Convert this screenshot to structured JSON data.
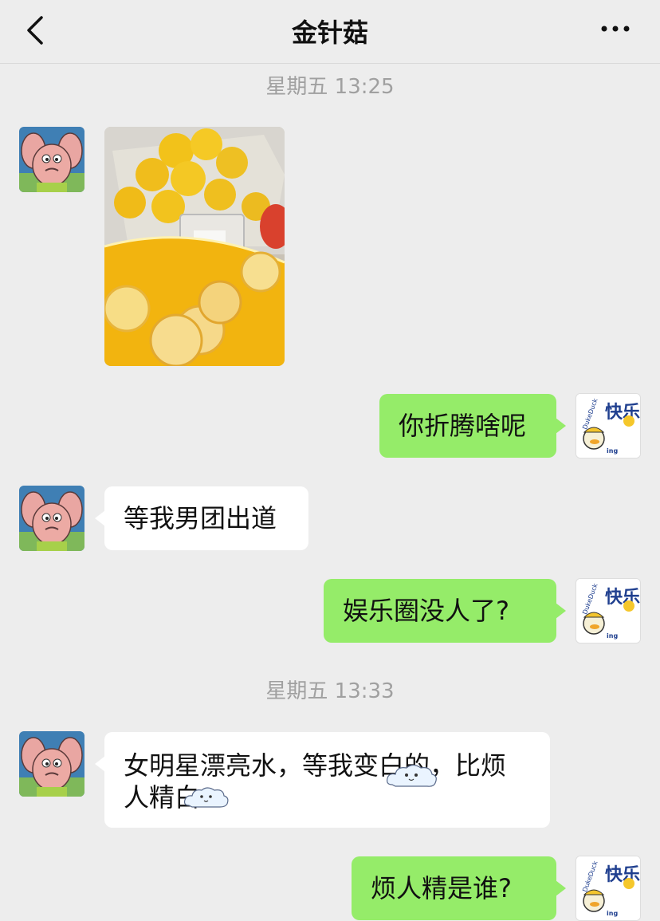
{
  "header": {
    "title": "金针菇",
    "back_icon": "chevron-left-icon",
    "more_icon": "more-dots-icon"
  },
  "messages": {
    "time1": "星期五 13:25",
    "msg1_text": "你折腾啥呢",
    "msg2_text": "等我男团出道",
    "msg3_text": "娱乐圈没人了?",
    "time2": "星期五 13:33",
    "msg4_line1": "女明星漂亮水，等我变白的，比烦",
    "msg4_line2": "人精白",
    "msg5_text": "烦人精是谁?"
  },
  "avatar_text": {
    "brand": "DukeDuck",
    "big": "快乐",
    "small": "ing"
  },
  "colors": {
    "background": "#ededed",
    "incoming_bubble": "#ffffff",
    "outgoing_bubble": "#95ec69"
  }
}
